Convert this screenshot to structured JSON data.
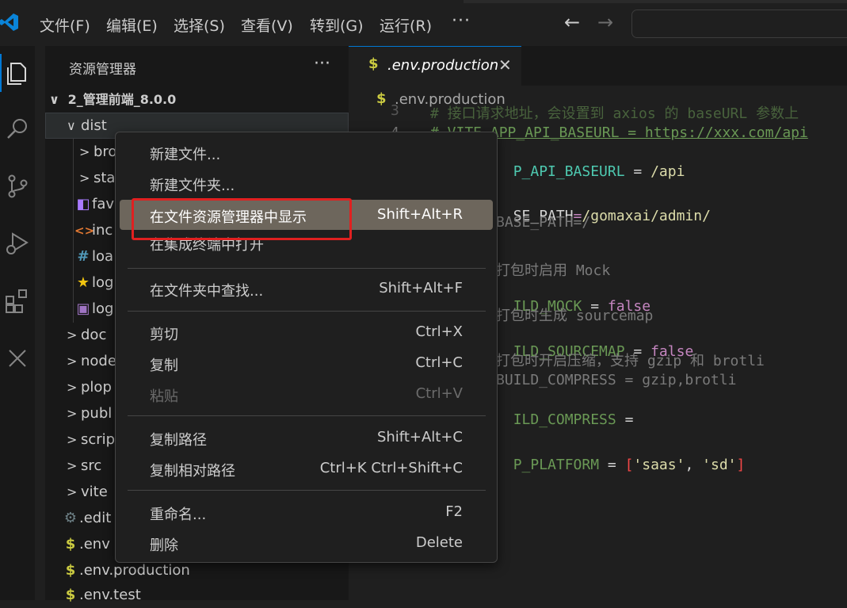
{
  "titlebar": {
    "menus": [
      "文件(F)",
      "编辑(E)",
      "选择(S)",
      "查看(V)",
      "转到(G)",
      "运行(R)"
    ],
    "more": "···",
    "nav_back": "←",
    "nav_forward": "→"
  },
  "sidebar": {
    "title": "资源管理器",
    "more": "···",
    "root": "2_管理前端_8.0.0",
    "items": [
      {
        "label": "dist",
        "icon": "chevron-down",
        "color": "#cccccc"
      },
      {
        "label": "bro",
        "icon": "chevron-right",
        "color": "#cccccc"
      },
      {
        "label": "sta",
        "icon": "chevron-right",
        "color": "#cccccc"
      },
      {
        "label": "fav",
        "icon": "vite-file-icon",
        "color": "#a97bff"
      },
      {
        "label": "inc",
        "icon": "html-icon",
        "color": "#e37933"
      },
      {
        "label": "loa",
        "icon": "css-hash-icon",
        "color": "#519aba"
      },
      {
        "label": "log",
        "icon": "star-icon",
        "color": "#f1c40f"
      },
      {
        "label": "log",
        "icon": "image-icon",
        "color": "#a074c4"
      },
      {
        "label": "doc",
        "icon": "chevron-right",
        "color": "#cccccc"
      },
      {
        "label": "node",
        "icon": "chevron-right",
        "color": "#cccccc"
      },
      {
        "label": "plop",
        "icon": "chevron-right",
        "color": "#cccccc"
      },
      {
        "label": "publ",
        "icon": "chevron-right",
        "color": "#cccccc"
      },
      {
        "label": "scrip",
        "icon": "chevron-right",
        "color": "#cccccc"
      },
      {
        "label": "src",
        "icon": "chevron-right",
        "color": "#cccccc"
      },
      {
        "label": "vite",
        "icon": "chevron-right",
        "color": "#cccccc"
      },
      {
        "label": ".edit",
        "icon": "gear-icon",
        "color": "#6d8086"
      },
      {
        "label": ".env",
        "icon": "dollar-icon",
        "color": "#cbcb41"
      },
      {
        "label": ".env.production",
        "icon": "dollar-icon",
        "color": "#cbcb41"
      },
      {
        "label": ".env.test",
        "icon": "dollar-icon",
        "color": "#cbcb41"
      }
    ]
  },
  "editor": {
    "tab_label": ".env.production",
    "tab_icon": "$",
    "breadcrumb": ".env.production",
    "lines": {
      "l3_num": "3",
      "l3_text": "# 接口请求地址，会设置到 axios 的 baseURL 参数上",
      "l4_num": "4",
      "l4_text": "# VITE_APP_API_BASEURL = https://xxx.com/api",
      "l5_key": "P_API_BASEURL",
      "l5_eq": " = ",
      "l5_val": "/api",
      "l7_key": "SE_PATH",
      "l7_eq": "=",
      "l7_val": "/gomaxai/admin/",
      "l8_text": "BASE_PATH=/",
      "l10_text": "打包时启用 Mock",
      "l11_key": "ILD_MOCK",
      "l11_eq": " = ",
      "l11_val": "false",
      "l12_text": "打包时生成 sourcemap",
      "l13_key": "ILD_SOURCEMAP",
      "l13_eq": " = ",
      "l13_val": "false",
      "l14_text": "打包时开启压缩，支持 gzip 和 brotli",
      "l15_text": "BUILD_COMPRESS = gzip,brotli",
      "l16_key": "ILD_COMPRESS",
      "l16_eq": " =",
      "l18_key": "P_PLATFORM",
      "l18_eq": " = ",
      "l18_open": "[",
      "l18_v1": "'saas'",
      "l18_comma": ", ",
      "l18_v2": "'sd'",
      "l18_close": "]"
    }
  },
  "context_menu": {
    "items": [
      {
        "label": "新建文件...",
        "shortcut": ""
      },
      {
        "label": "新建文件夹...",
        "shortcut": ""
      },
      {
        "label": "在文件资源管理器中显示",
        "shortcut": "Shift+Alt+R"
      },
      {
        "label": "在集成终端中打开",
        "shortcut": ""
      },
      {
        "label": "在文件夹中查找...",
        "shortcut": "Shift+Alt+F"
      },
      {
        "label": "剪切",
        "shortcut": "Ctrl+X"
      },
      {
        "label": "复制",
        "shortcut": "Ctrl+C"
      },
      {
        "label": "粘贴",
        "shortcut": "Ctrl+V"
      },
      {
        "label": "复制路径",
        "shortcut": "Shift+Alt+C"
      },
      {
        "label": "复制相对路径",
        "shortcut": "Ctrl+K Ctrl+Shift+C"
      },
      {
        "label": "重命名...",
        "shortcut": "F2"
      },
      {
        "label": "删除",
        "shortcut": "Delete"
      }
    ]
  },
  "colors": {
    "accent": "#0078d4",
    "highlight_box": "#e02020",
    "menu_hover": "#6d665c"
  }
}
